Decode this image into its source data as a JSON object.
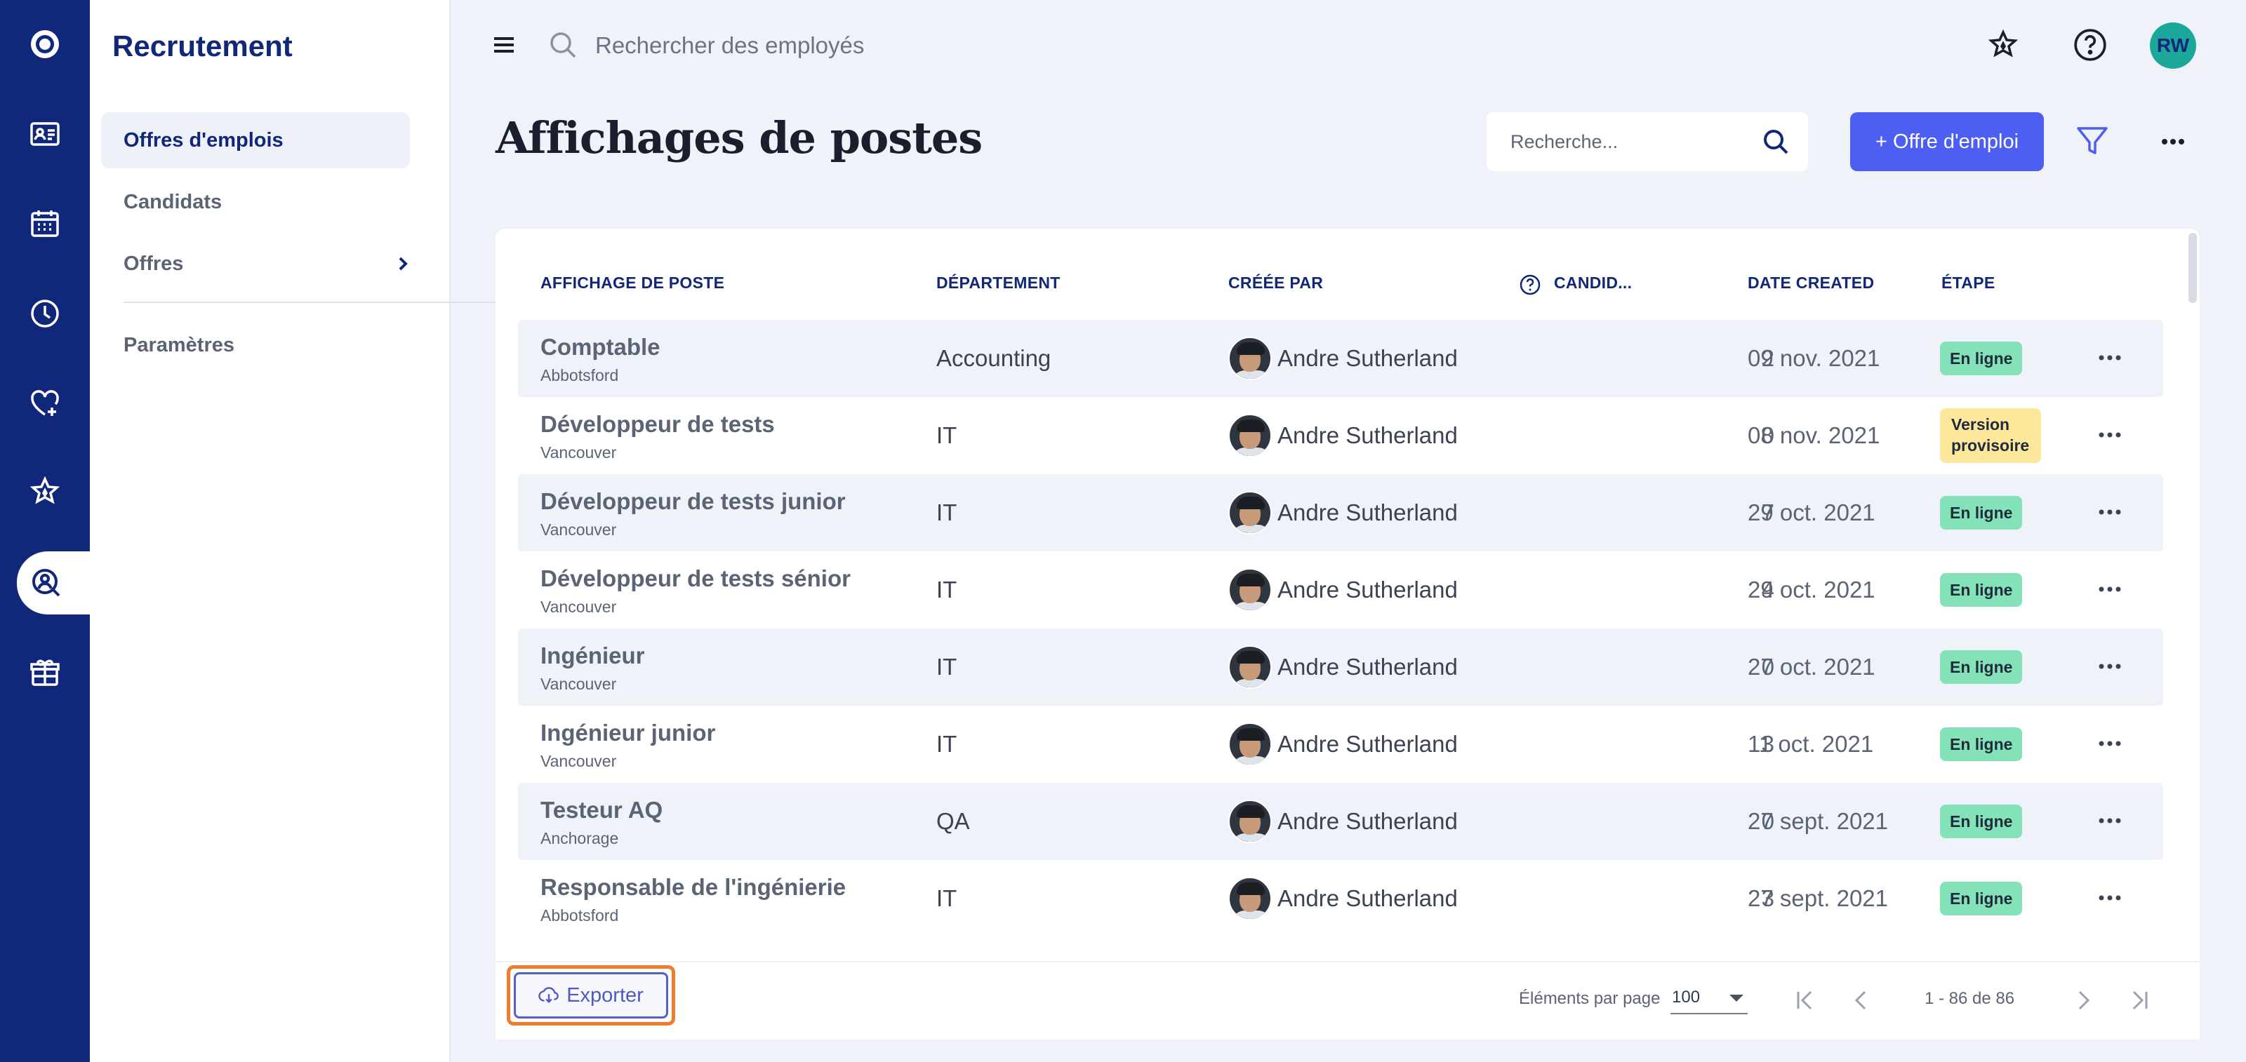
{
  "app": {
    "section_title": "Recrutement",
    "rail_icons": [
      "logo-icon",
      "id-card-icon",
      "calendar-icon",
      "clock-icon",
      "heart-plus-icon",
      "star-icon",
      "user-search-icon",
      "gift-icon"
    ]
  },
  "subnav": {
    "items": [
      {
        "label": "Offres d'emplois",
        "active": true
      },
      {
        "label": "Candidats",
        "active": false
      },
      {
        "label": "Offres",
        "active": false,
        "has_submenu": true
      },
      {
        "label": "Paramètres",
        "active": false
      }
    ]
  },
  "topbar": {
    "search_placeholder": "Rechercher des employés",
    "user_initials": "RW",
    "avatar_color": "#1ba89a"
  },
  "page": {
    "title": "Affichages de postes",
    "search_placeholder": "Recherche...",
    "new_button_label": "+ Offre d'emploi",
    "accent_color": "#4c5ff2"
  },
  "table": {
    "headers": [
      "AFFICHAGE DE POSTE",
      "DÉPARTEMENT",
      "CRÉÉE PAR",
      "CANDID...",
      "DATE CREATED",
      "ÉTAPE"
    ],
    "rows": [
      {
        "title": "Comptable",
        "location": "Abbotsford",
        "department": "Accounting",
        "created_by": "Andre Sutherland",
        "candidates": "2",
        "date": "09 nov. 2021",
        "stage": "En ligne",
        "stage_type": "online"
      },
      {
        "title": "Développeur de tests",
        "location": "Vancouver",
        "department": "IT",
        "created_by": "Andre Sutherland",
        "candidates": "0",
        "date": "08 nov. 2021",
        "stage": "Version provisoire",
        "stage_type": "draft"
      },
      {
        "title": "Développeur de tests junior",
        "location": "Vancouver",
        "department": "IT",
        "created_by": "Andre Sutherland",
        "candidates": "7",
        "date": "29 oct. 2021",
        "stage": "En ligne",
        "stage_type": "online"
      },
      {
        "title": "Développeur de tests sénior",
        "location": "Vancouver",
        "department": "IT",
        "created_by": "Andre Sutherland",
        "candidates": "4",
        "date": "29 oct. 2021",
        "stage": "En ligne",
        "stage_type": "online"
      },
      {
        "title": "Ingénieur",
        "location": "Vancouver",
        "department": "IT",
        "created_by": "Andre Sutherland",
        "candidates": "0",
        "date": "27 oct. 2021",
        "stage": "En ligne",
        "stage_type": "online"
      },
      {
        "title": "Ingénieur junior",
        "location": "Vancouver",
        "department": "IT",
        "created_by": "Andre Sutherland",
        "candidates": "3",
        "date": "11 oct. 2021",
        "stage": "En ligne",
        "stage_type": "online"
      },
      {
        "title": "Testeur AQ",
        "location": "Anchorage",
        "department": "QA",
        "created_by": "Andre Sutherland",
        "candidates": "0",
        "date": "27 sept. 2021",
        "stage": "En ligne",
        "stage_type": "online"
      },
      {
        "title": "Responsable de l'ingénierie",
        "location": "Abbotsford",
        "department": "IT",
        "created_by": "Andre Sutherland",
        "candidates": "3",
        "date": "27 sept. 2021",
        "stage": "En ligne",
        "stage_type": "online"
      }
    ],
    "stage_colors": {
      "online": "#84e2b8",
      "draft": "#fde79b"
    }
  },
  "footer": {
    "export_label": "Exporter",
    "per_page_label": "Éléments par page",
    "per_page_value": "100",
    "range_text": "1 - 86 de 86"
  }
}
